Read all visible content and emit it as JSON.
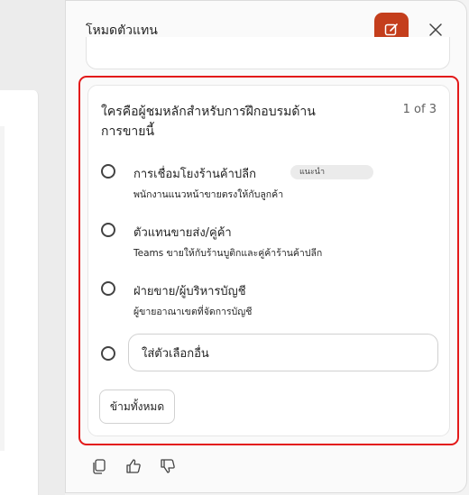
{
  "panel": {
    "title": "โหมดตัวแทน",
    "compose_icon": "compose-icon",
    "close_icon": "close-icon",
    "accent_color": "#c43e1c",
    "highlight_color": "#e31919"
  },
  "question": {
    "text": "ใครคือผู้ชมหลักสำหรับการฝึกอบรมด้านการขายนี้",
    "counter": "1 of 3",
    "options": [
      {
        "label": "การเชื่อมโยงร้านค้าปลีก",
        "badge": "แนะนำ",
        "description": "พนักงานแนวหน้าขายตรงให้กับลูกค้า"
      },
      {
        "label": "ตัวแทนขายส่ง/คู่ค้า",
        "description": "Teams ขายให้กับร้านบูติกและคู่ค้าร้านค้าปลีก"
      },
      {
        "label": "ฝ่ายขาย/ผู้บริหารบัญชี",
        "description": "ผู้ขายอาณาเขตที่จัดการบัญชี"
      }
    ],
    "other_placeholder": "ใส่ตัวเลือกอื่น",
    "skip_label": "ข้ามทั้งหมด"
  },
  "footer": {
    "icons": [
      "copy-icon",
      "thumbs-up-icon",
      "thumbs-down-icon"
    ]
  }
}
